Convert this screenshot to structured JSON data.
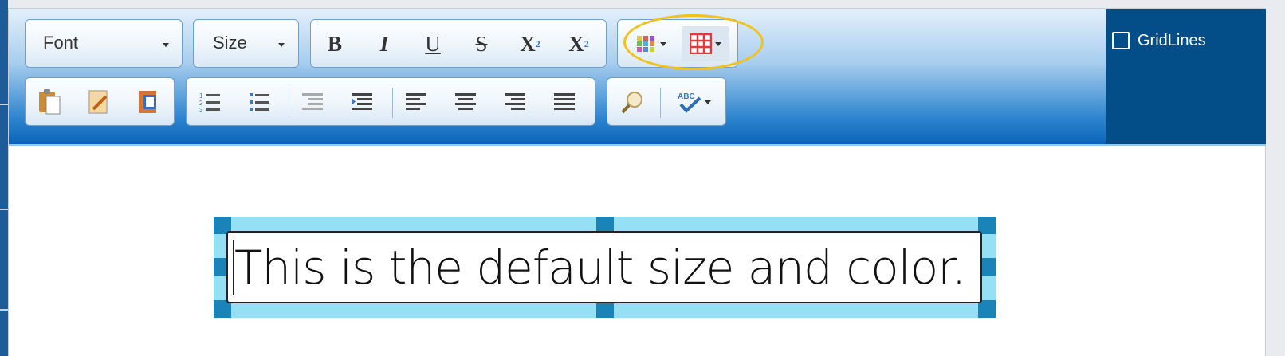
{
  "toolbar": {
    "font_dropdown": {
      "label": "Font"
    },
    "size_dropdown": {
      "label": "Size"
    },
    "format_buttons": [
      "bold",
      "italic",
      "underline",
      "strikethrough",
      "subscript",
      "superscript"
    ],
    "color_picker_icon": "color-palette-icon",
    "table_icon": "insert-table-icon",
    "clipboard_icons": [
      "paste-icon",
      "paste-plain-text-icon",
      "paste-from-word-icon"
    ],
    "list_icons": [
      "numbered-list-icon",
      "bulleted-list-icon"
    ],
    "indent_icons": [
      "outdent-icon",
      "indent-icon"
    ],
    "align_icons": [
      "align-left-icon",
      "align-center-icon",
      "align-right-icon",
      "justify-icon"
    ],
    "find_icon": "find-icon",
    "spellcheck_icon": "spellcheck-icon",
    "highlight_color": "#f2c21a",
    "accent_color": "#034d88"
  },
  "gridlines": {
    "label": "GridLines",
    "checked": false
  },
  "canvas": {
    "text": "This is the default size and color.",
    "selection_color": "#96e0f6",
    "handle_color": "#1a83b7"
  }
}
